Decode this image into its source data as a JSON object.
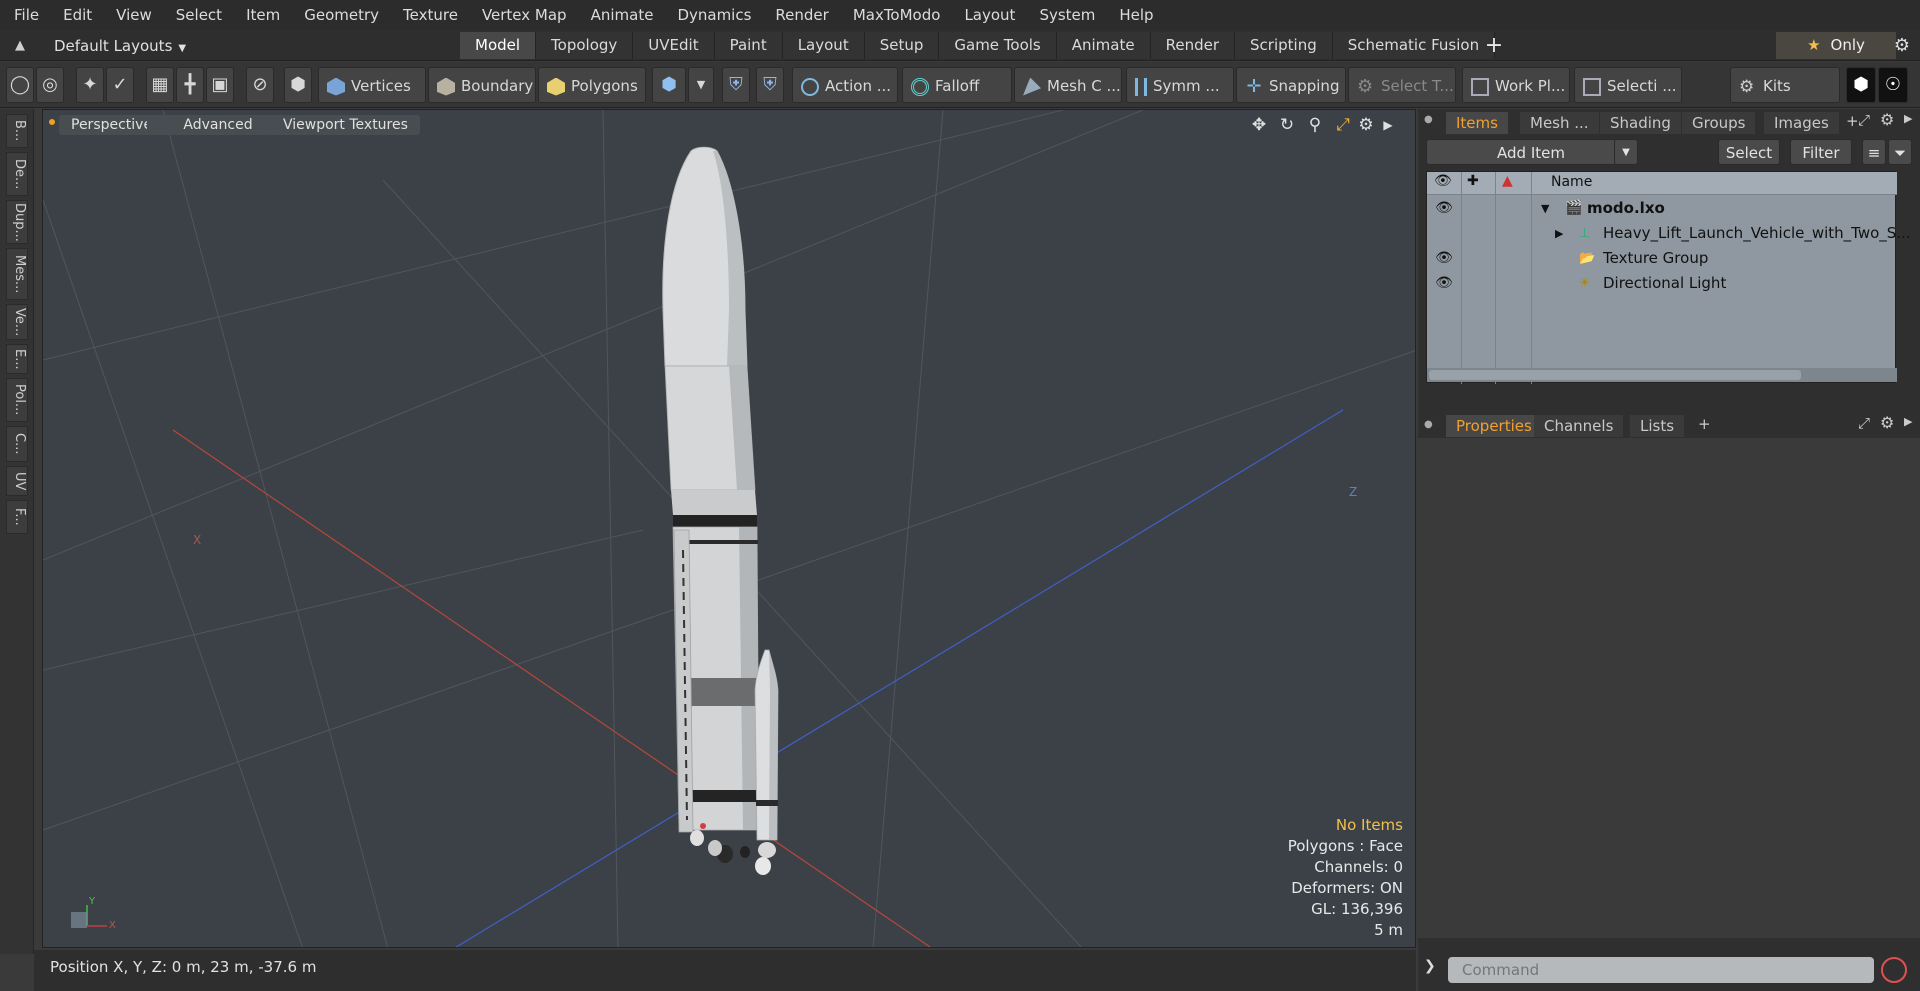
{
  "menu": [
    "File",
    "Edit",
    "View",
    "Select",
    "Item",
    "Geometry",
    "Texture",
    "Vertex Map",
    "Animate",
    "Dynamics",
    "Render",
    "MaxToModo",
    "Layout",
    "System",
    "Help"
  ],
  "layout_dropdown": "Default Layouts",
  "mode_tabs": [
    "Model",
    "Topology",
    "UVEdit",
    "Paint",
    "Layout",
    "Setup",
    "Game Tools",
    "Animate",
    "Render",
    "Scripting",
    "Schematic Fusion"
  ],
  "active_mode_tab": "Model",
  "only_label": "Only",
  "toolbar": {
    "vertices": "Vertices",
    "boundary": "Boundary",
    "polygons": "Polygons",
    "action": "Action",
    "action_more": "...",
    "falloff": "Falloff",
    "mesh_c": "Mesh C ...",
    "symm": "Symm ...",
    "snapping": "Snapping",
    "select_t": "Select T...",
    "work_pl": "Work Pl...",
    "selecti": "Selecti ...",
    "kits": "Kits"
  },
  "left_tabs": [
    "B...",
    "De...",
    "Dup...",
    "Mes...",
    "Ve...",
    "E...",
    "Pol...",
    "C...",
    "UV",
    "F..."
  ],
  "viewport": {
    "perspective": "Perspective",
    "advanced": "Advanced",
    "viewport_textures": "Viewport Textures",
    "hud": {
      "selection": "No Items",
      "polygons": "Polygons : Face",
      "channels": "Channels: 0",
      "deformers": "Deformers: ON",
      "gl": "GL: 136,396",
      "scale": "5 m"
    },
    "axis_labels": {
      "x": "X",
      "y": "Y",
      "z": "Z"
    }
  },
  "status": {
    "position": "Position X, Y, Z:   0 m, 23 m, -37.6 m"
  },
  "items_panel": {
    "tabs": [
      "Items",
      "Mesh ...",
      "Shading",
      "Groups",
      "Images"
    ],
    "active_tab": "Items",
    "add_item": "Add Item",
    "select": "Select",
    "filter": "Filter",
    "name_header": "Name",
    "rows": [
      {
        "label": "modo.lxo",
        "visible": true
      },
      {
        "label": "Heavy_Lift_Launch_Vehicle_with_Two_S...",
        "visible": false
      },
      {
        "label": "Texture Group",
        "visible": true
      },
      {
        "label": "Directional Light",
        "visible": true
      }
    ]
  },
  "properties_panel": {
    "tabs": [
      "Properties",
      "Channels",
      "Lists"
    ],
    "active_tab": "Properties"
  },
  "command": {
    "placeholder": "Command"
  },
  "colors": {
    "accent": "#f2a030",
    "viewport_bg": "#3b4147",
    "tree_bg": "#8f98a0"
  }
}
